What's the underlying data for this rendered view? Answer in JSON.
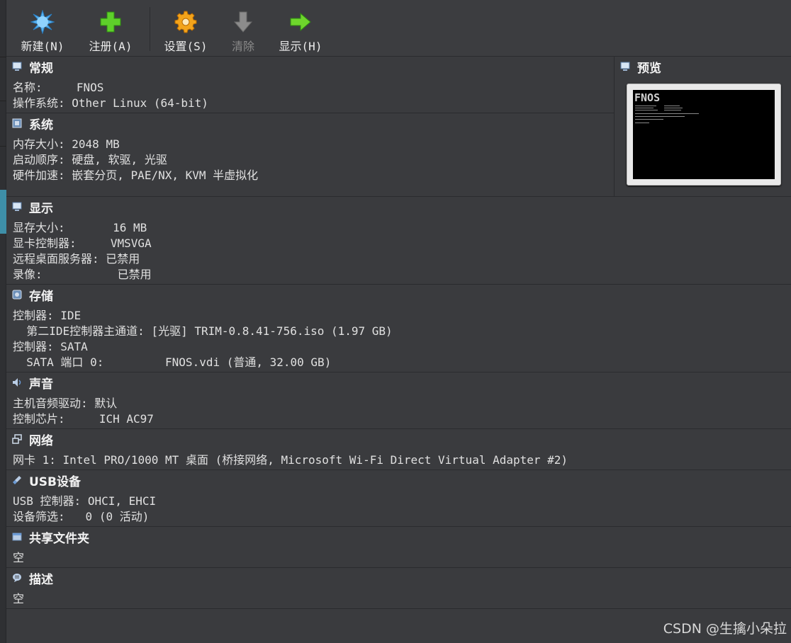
{
  "toolbar": {
    "new_label": "新建(N)",
    "register_label": "注册(A)",
    "settings_label": "设置(S)",
    "discard_label": "清除",
    "show_label": "显示(H)"
  },
  "general": {
    "title": "常规",
    "rows": [
      {
        "k": "名称:     ",
        "v": "FNOS"
      },
      {
        "k": "操作系统: ",
        "v": "Other Linux (64-bit)"
      }
    ]
  },
  "system": {
    "title": "系统",
    "rows": [
      {
        "k": "内存大小: ",
        "v": "2048 MB"
      },
      {
        "k": "启动顺序: ",
        "v": "硬盘, 软驱, 光驱"
      },
      {
        "k": "硬件加速: ",
        "v": "嵌套分页, PAE/NX, KVM 半虚拟化"
      }
    ]
  },
  "preview": {
    "title": "预览",
    "logo": "FNOS"
  },
  "display": {
    "title": "显示",
    "rows": [
      {
        "k": "显存大小:       ",
        "v": "16 MB"
      },
      {
        "k": "显卡控制器:     ",
        "v": "VMSVGA"
      },
      {
        "k": "远程桌面服务器: ",
        "v": "已禁用"
      },
      {
        "k": "录像:           ",
        "v": "已禁用"
      }
    ]
  },
  "storage": {
    "title": "存储",
    "rows": [
      {
        "k": "控制器: ",
        "v": "IDE"
      },
      {
        "k": "  第二IDE控制器主通道: ",
        "v": "[光驱] TRIM-0.8.41-756.iso (1.97 GB)"
      },
      {
        "k": "控制器: ",
        "v": "SATA"
      },
      {
        "k": "  SATA 端口 0:         ",
        "v": "FNOS.vdi (普通, 32.00 GB)"
      }
    ]
  },
  "audio": {
    "title": "声音",
    "rows": [
      {
        "k": "主机音频驱动: ",
        "v": "默认"
      },
      {
        "k": "控制芯片:     ",
        "v": "ICH AC97"
      }
    ]
  },
  "network": {
    "title": "网络",
    "rows": [
      {
        "k": "网卡 1: ",
        "v": "Intel PRO/1000 MT 桌面 (桥接网络, Microsoft Wi-Fi Direct Virtual Adapter #2)"
      }
    ]
  },
  "usb": {
    "title": "USB设备",
    "rows": [
      {
        "k": "USB 控制器: ",
        "v": "OHCI, EHCI"
      },
      {
        "k": "设备筛选:   ",
        "v": "0 (0 活动)"
      }
    ]
  },
  "shared": {
    "title": "共享文件夹",
    "value": "空"
  },
  "description": {
    "title": "描述",
    "value": "空"
  },
  "watermark": "CSDN @生擒小朵拉",
  "colors": {
    "background": "#3a3b3e",
    "toolbar": "#3c3d40",
    "selection_strip": "#3e8fa8",
    "text": "#e0e0e0"
  }
}
